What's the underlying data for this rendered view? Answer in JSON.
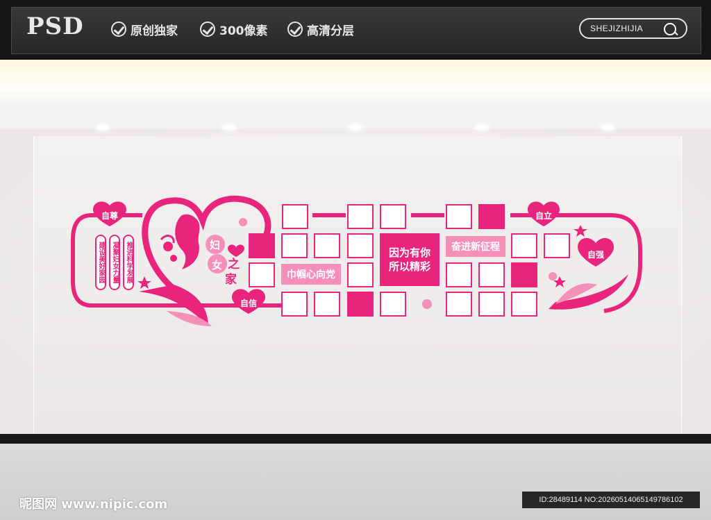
{
  "header": {
    "logo": "PSD",
    "features": [
      "原创独家",
      "300像素",
      "高清分层"
    ],
    "search_text": "SHEJIZHIJIA"
  },
  "design": {
    "title_chars": [
      "妇",
      "女",
      "之",
      "家"
    ],
    "hearts": [
      "自尊",
      "自信",
      "自立",
      "自强"
    ],
    "vertical_slogans": [
      "建设美好家园",
      "凝聚妇女力量",
      "推进科学发展"
    ],
    "center_slogan_line1": "因为有你",
    "center_slogan_line2": "所以精彩",
    "slogan_left": "巾帼心向党",
    "slogan_right": "奋进新征程",
    "colors": {
      "accent": "#e8247c",
      "light": "#f48fb8",
      "dark": "#c4145f"
    }
  },
  "watermark": {
    "site": "昵图网 www.nipic.com",
    "id_text": "ID:28489114 NO:20260514065149786102"
  }
}
